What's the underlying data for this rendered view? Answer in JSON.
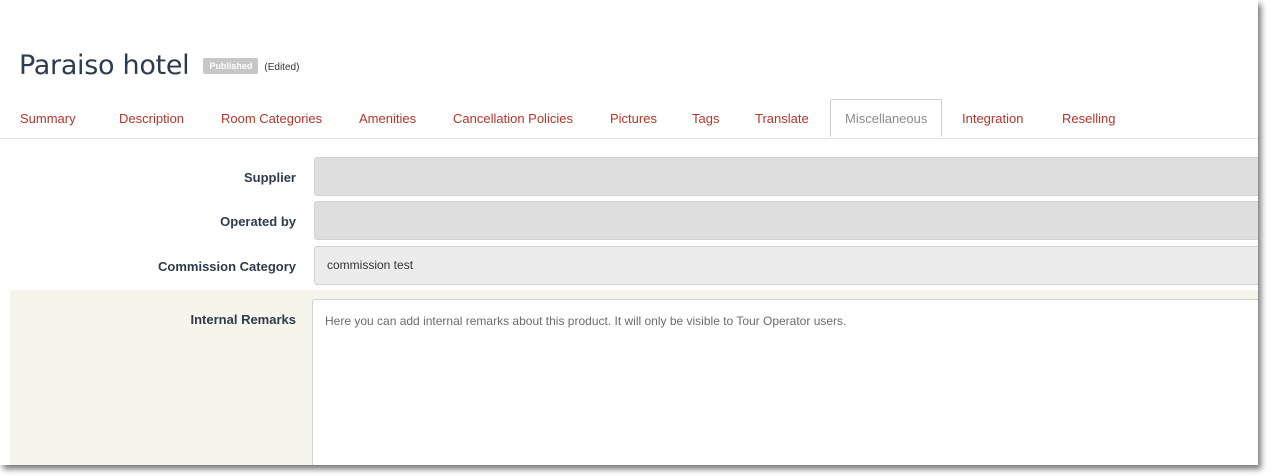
{
  "page": {
    "title": "Paraiso hotel",
    "status_badge": "Published",
    "edited_label": "(Edited)"
  },
  "tabs": [
    {
      "label": "Summary"
    },
    {
      "label": "Description"
    },
    {
      "label": "Room Categories"
    },
    {
      "label": "Amenities"
    },
    {
      "label": "Cancellation Policies"
    },
    {
      "label": "Pictures"
    },
    {
      "label": "Tags"
    },
    {
      "label": "Translate"
    },
    {
      "label": "Miscellaneous",
      "active": true
    },
    {
      "label": "Integration"
    },
    {
      "label": "Reselling"
    }
  ],
  "form": {
    "supplier": {
      "label": "Supplier",
      "value": ""
    },
    "operated_by": {
      "label": "Operated by",
      "value": ""
    },
    "commission_category": {
      "label": "Commission Category",
      "value": "commission test"
    },
    "internal_remarks": {
      "label": "Internal Remarks",
      "value": "",
      "placeholder": "Here you can add internal remarks about this product. It will only be visible to Tour Operator users."
    }
  },
  "colors": {
    "tab_link": "#b3362a",
    "tab_active": "#8c8c8c",
    "title": "#2f3b4c",
    "remarks_background": "#f5f5ec"
  }
}
